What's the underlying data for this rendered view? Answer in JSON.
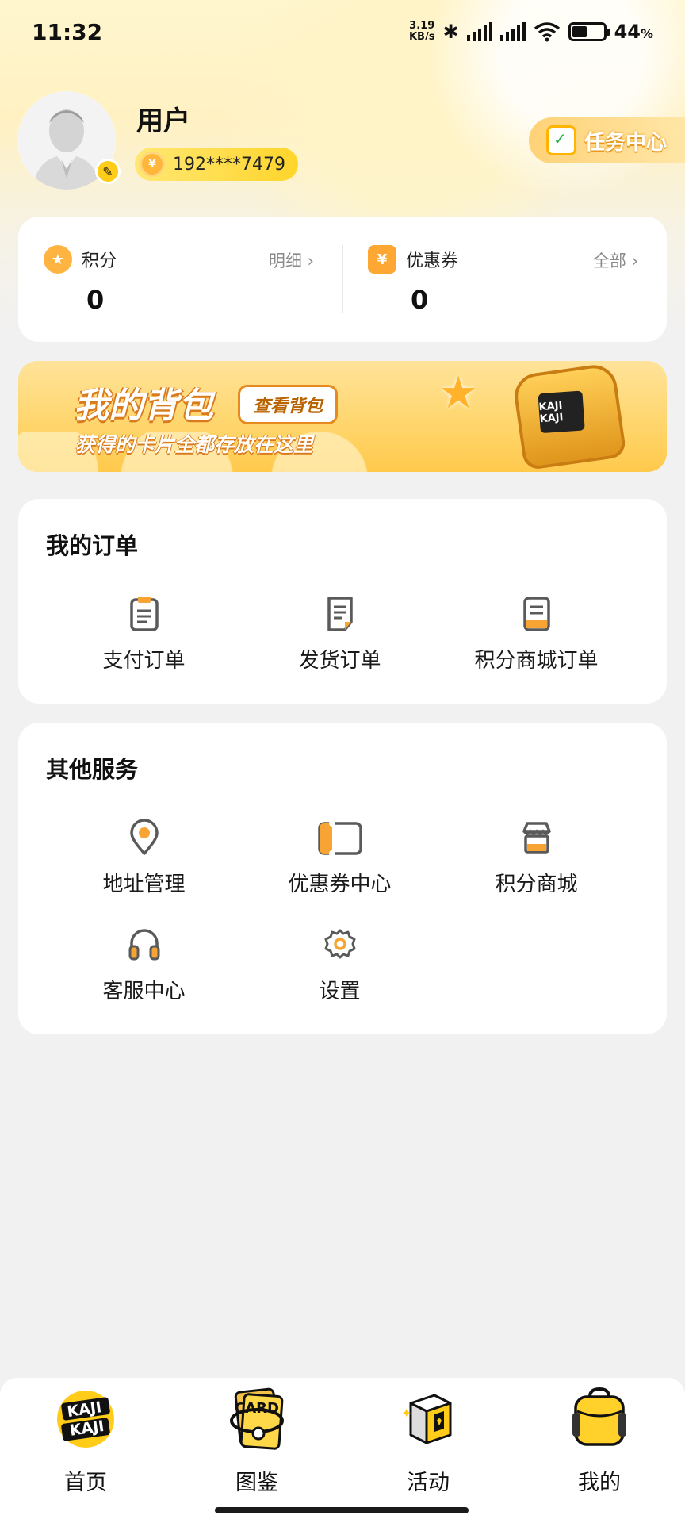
{
  "status_bar": {
    "time": "11:32",
    "net_speed_value": "3.19",
    "net_speed_unit": "KB/s",
    "battery_percent": "44",
    "percent_sign": "%"
  },
  "profile": {
    "name": "用户",
    "phone": "192****7479",
    "task_center": "任务中心"
  },
  "points_card": {
    "points": {
      "label": "积分",
      "link": "明细",
      "value": "0"
    },
    "coupons": {
      "label": "优惠券",
      "link": "全部",
      "value": "0"
    }
  },
  "banner": {
    "title": "我的背包",
    "button": "查看背包",
    "subtitle": "获得的卡片全都存放在这里",
    "bag_logo": "KAJI KAJI"
  },
  "orders": {
    "title": "我的订单",
    "items": [
      {
        "label": "支付订单",
        "icon": "clipboard-icon"
      },
      {
        "label": "发货订单",
        "icon": "document-edit-icon"
      },
      {
        "label": "积分商城订单",
        "icon": "document-list-icon"
      }
    ]
  },
  "services": {
    "title": "其他服务",
    "items": [
      {
        "label": "地址管理",
        "icon": "location-pin-icon"
      },
      {
        "label": "优惠券中心",
        "icon": "ticket-icon"
      },
      {
        "label": "积分商城",
        "icon": "store-icon"
      },
      {
        "label": "客服中心",
        "icon": "headphones-icon"
      },
      {
        "label": "设置",
        "icon": "gear-icon"
      }
    ]
  },
  "bottom_nav": {
    "items": [
      {
        "label": "首页",
        "icon_text": "KAJI KAJI"
      },
      {
        "label": "图鉴",
        "icon_text": "CARD"
      },
      {
        "label": "活动",
        "icon_text": ""
      },
      {
        "label": "我的",
        "icon_text": ""
      }
    ]
  },
  "colors": {
    "accent": "#ffcc1a",
    "orange": "#f7a434",
    "icon_gray": "#5a5a5a",
    "background": "#f1f1f1"
  }
}
